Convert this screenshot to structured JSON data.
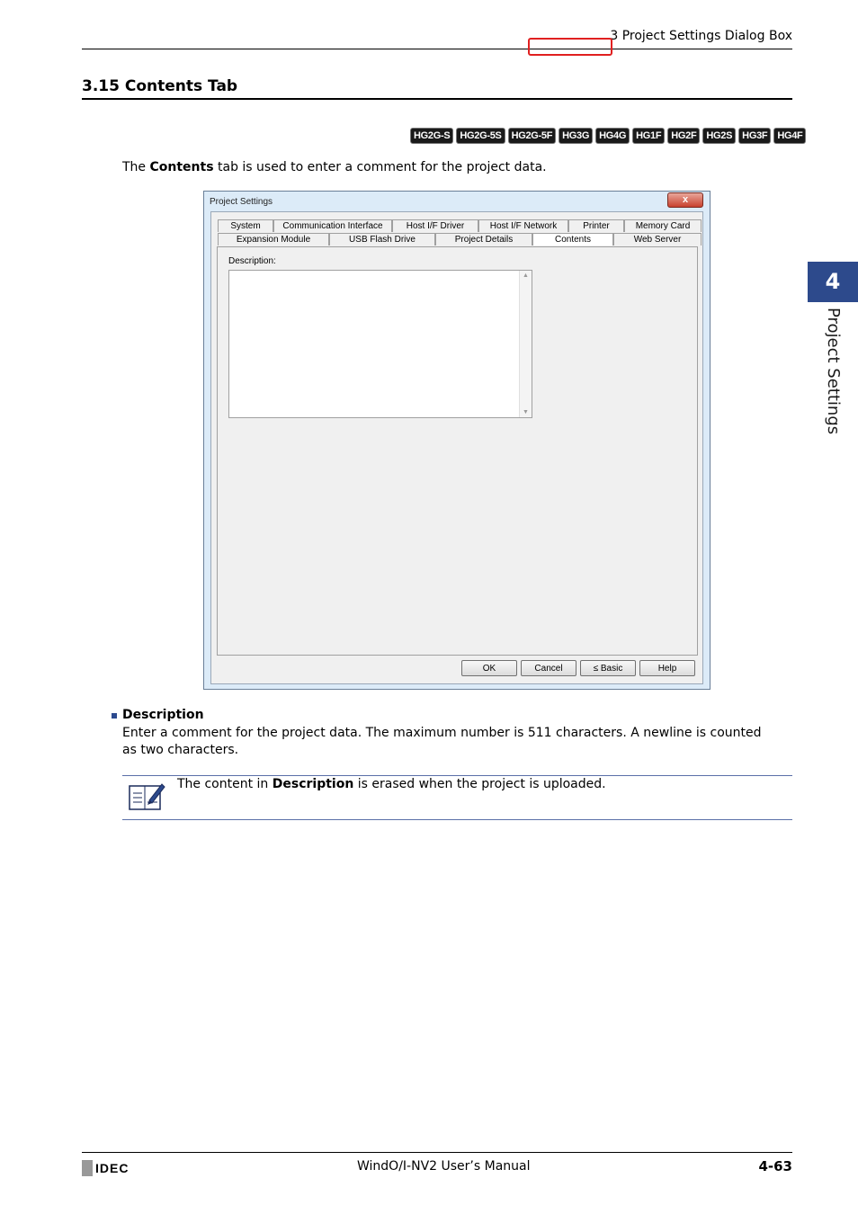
{
  "header": {
    "section": "3 Project Settings Dialog Box"
  },
  "title": "3.15 Contents Tab",
  "badges": [
    "HG2G-S",
    "HG2G-5S",
    "HG2G-5F",
    "HG3G",
    "HG4G",
    "HG1F",
    "HG2F",
    "HG2S",
    "HG3F",
    "HG4F"
  ],
  "intro": {
    "prefix": "The ",
    "bold": "Contents",
    "suffix": " tab is used to enter a comment for the project data."
  },
  "dialog": {
    "title": "Project Settings",
    "close": "x",
    "tabs_row1": [
      "System",
      "Communication Interface",
      "Host I/F Driver",
      "Host I/F Network",
      "Printer",
      "Memory Card"
    ],
    "tabs_row2": [
      "Expansion Module",
      "USB Flash Drive",
      "Project Details",
      "Contents",
      "Web Server"
    ],
    "active_tab": "Contents",
    "description_label": "Description:",
    "scroll_up": "▲",
    "scroll_down": "▼",
    "buttons": {
      "ok": "OK",
      "cancel": "Cancel",
      "basic": "≤ Basic",
      "help": "Help"
    }
  },
  "item": {
    "title": "Description",
    "body": "Enter a comment for the project data. The maximum number is 511 characters. A newline is counted as two characters."
  },
  "note": {
    "prefix": "The content in ",
    "bold": "Description",
    "suffix": " is erased when the project is uploaded."
  },
  "side": {
    "chapter": "4",
    "label": "Project Settings"
  },
  "footer": {
    "logo": "IDEC",
    "manual": "WindO/I-NV2 User’s Manual",
    "page": "4-63"
  }
}
